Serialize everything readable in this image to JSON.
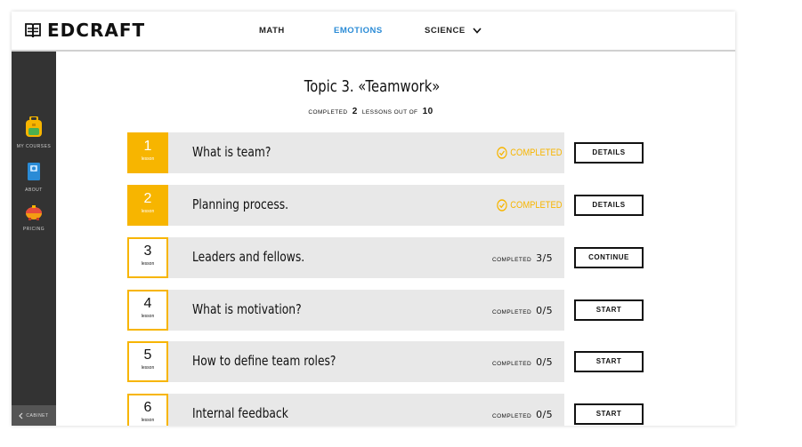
{
  "app": {
    "logo_text": "EDCRAFT"
  },
  "nav": {
    "math": "MATH",
    "emotions": "EMOTIONS",
    "science": "SCIENCE"
  },
  "sidebar": {
    "items": [
      {
        "label": "MY COURSES",
        "icon": "backpack-icon"
      },
      {
        "label": "ABOUT",
        "icon": "book-icon"
      },
      {
        "label": "PRICING",
        "icon": "piggy-bank-icon"
      }
    ],
    "cabinet": "CABINET"
  },
  "topic": {
    "title": "Topic 3. «Teamwork»",
    "summary_prefix": "COMPLETED",
    "completed_count": "2",
    "summary_mid": "LESSONS OUT OF",
    "total_count": "10"
  },
  "lessons": [
    {
      "num": "1",
      "word": "lesson",
      "title": "What is team?",
      "status": "COMPLETED",
      "state": "done",
      "button": "DETAILS"
    },
    {
      "num": "2",
      "word": "lesson",
      "title": "Planning process.",
      "status": "COMPLETED",
      "state": "done",
      "button": "DETAILS"
    },
    {
      "num": "3",
      "word": "lesson",
      "title": "Leaders and fellows.",
      "progress_label": "COMPLETED",
      "progress": "3/5",
      "state": "todo",
      "button": "CONTINUE"
    },
    {
      "num": "4",
      "word": "lesson",
      "title": "What is motivation?",
      "progress_label": "COMPLETED",
      "progress": "0/5",
      "state": "todo",
      "button": "START"
    },
    {
      "num": "5",
      "word": "lesson",
      "title": "How to define team roles?",
      "progress_label": "COMPLETED",
      "progress": "0/5",
      "state": "todo",
      "button": "START"
    },
    {
      "num": "6",
      "word": "lesson",
      "title": "Internal feedback",
      "progress_label": "COMPLETED",
      "progress": "0/5",
      "state": "todo",
      "button": "START"
    }
  ],
  "colors": {
    "accent": "#f7b500",
    "nav_active": "#2a8bd6",
    "sidebar": "#333333",
    "row_bg": "#e8e8e8"
  }
}
